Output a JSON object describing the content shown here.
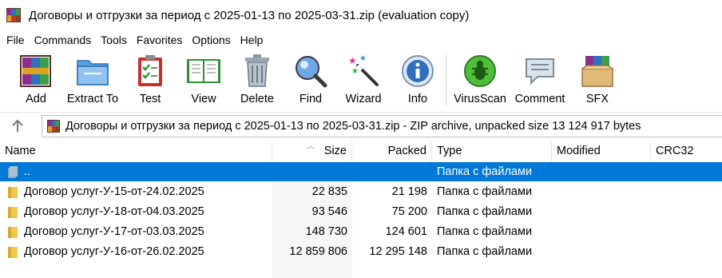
{
  "window": {
    "title": "Договоры и отгрузки за период с 2025-01-13 по 2025-03-31.zip (evaluation copy)"
  },
  "menu": [
    "File",
    "Commands",
    "Tools",
    "Favorites",
    "Options",
    "Help"
  ],
  "toolbar": {
    "add": "Add",
    "extract": "Extract To",
    "test": "Test",
    "view": "View",
    "delete": "Delete",
    "find": "Find",
    "wizard": "Wizard",
    "info": "Info",
    "virusscan": "VirusScan",
    "comment": "Comment",
    "sfx": "SFX"
  },
  "address": {
    "text": "Договоры и отгрузки за период с 2025-01-13 по 2025-03-31.zip - ZIP archive, unpacked size 13 124 917 bytes"
  },
  "columns": {
    "name": "Name",
    "size": "Size",
    "packed": "Packed",
    "type": "Type",
    "modified": "Modified",
    "crc": "CRC32"
  },
  "files": [
    {
      "name": "..",
      "size": "",
      "packed": "",
      "type": "Папка с файлами",
      "modified": "",
      "crc": "",
      "selected": true
    },
    {
      "name": "Договор услуг-У-15-от-24.02.2025",
      "size": "22 835",
      "packed": "21 198",
      "type": "Папка с файлами",
      "modified": "",
      "crc": ""
    },
    {
      "name": "Договор услуг-У-18-от-04.03.2025",
      "size": "93 546",
      "packed": "75 200",
      "type": "Папка с файлами",
      "modified": "",
      "crc": ""
    },
    {
      "name": "Договор услуг-У-17-от-03.03.2025",
      "size": "148 730",
      "packed": "124 601",
      "type": "Папка с файлами",
      "modified": "",
      "crc": ""
    },
    {
      "name": "Договор услуг-У-16-от-26.02.2025",
      "size": "12 859 806",
      "packed": "12 295 148",
      "type": "Папка с файлами",
      "modified": "",
      "crc": ""
    }
  ],
  "colors": {
    "selection": "#0078d7",
    "folder": "#f2c84b"
  }
}
